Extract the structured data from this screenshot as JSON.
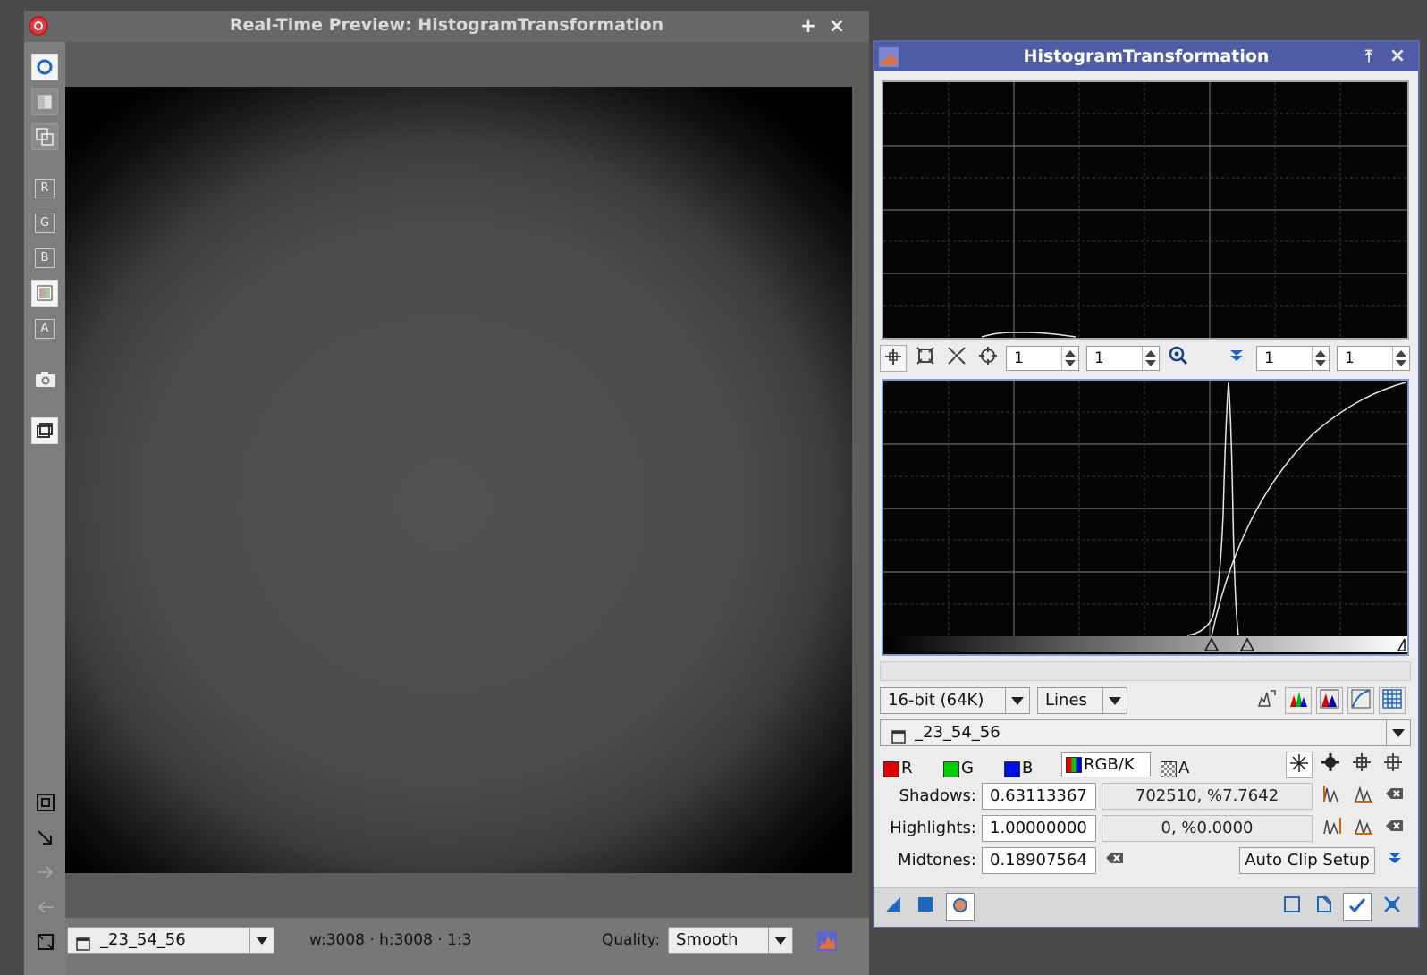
{
  "preview": {
    "title": "Real-Time Preview: HistogramTransformation",
    "title_buttons": {
      "plus": "+",
      "close": "×"
    },
    "toolbar": {
      "channel_r": "R",
      "channel_g": "G",
      "channel_b": "B",
      "channel_a": "A"
    },
    "status": {
      "view": "_23_54_56",
      "dimensions": "w:3008 · h:3008 · 1:3",
      "quality_label": "Quality:",
      "quality_value": "Smooth"
    }
  },
  "histogram": {
    "title": "HistogramTransformation",
    "title_buttons": {
      "shade": "⤒",
      "close": "×"
    },
    "zoom_controls": {
      "horz_zoom_1": "1",
      "vert_zoom_1": "1",
      "horz_zoom_2": "1",
      "vert_zoom_2": "1"
    },
    "resolution": "16-bit (64K)",
    "graph_style": "Lines",
    "view": "_23_54_56",
    "channels": {
      "r": "R",
      "g": "G",
      "b": "B",
      "rgbk": "RGB/K",
      "a": "A"
    },
    "shadows": {
      "label": "Shadows:",
      "value": "0.63113367",
      "clipping": "702510, %7.7642"
    },
    "highlights": {
      "label": "Highlights:",
      "value": "1.00000000",
      "clipping": "0, %0.0000"
    },
    "midtones": {
      "label": "Midtones:",
      "value": "0.18907564"
    },
    "auto_clip_setup": "Auto Clip Setup",
    "colors": {
      "title_bar": "#4f5ca6",
      "accent_blue": "#1f66c0",
      "red": "#e00000",
      "green": "#00d000",
      "blue": "#0010e0"
    }
  }
}
